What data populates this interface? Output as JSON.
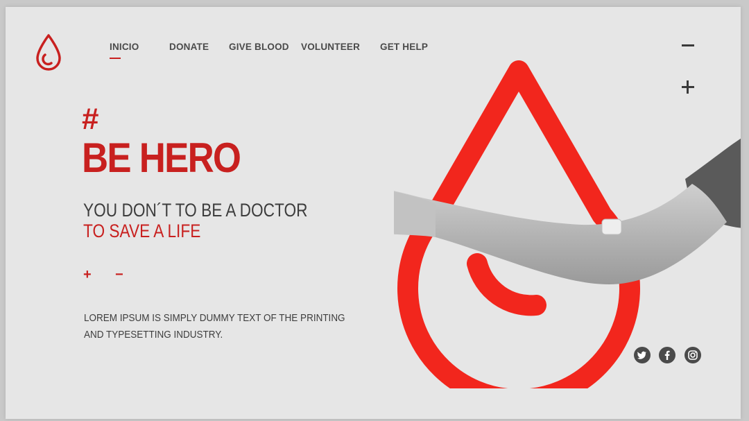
{
  "nav": {
    "items": [
      {
        "label": "INICIO",
        "active": true
      },
      {
        "label": "DONATE",
        "active": false
      },
      {
        "label": "GIVE BLOOD",
        "active": false
      },
      {
        "label": "VOLUNTEER",
        "active": false
      },
      {
        "label": "GET HELP",
        "active": false
      }
    ]
  },
  "hero": {
    "hash": "#",
    "title": "BE HERO",
    "subtitle": "YOU DON´T TO BE A DOCTOR",
    "subtitle_red": "TO SAVE A LIFE",
    "plus": "+",
    "minus": "−",
    "body": "LOREM IPSUM IS SIMPLY DUMMY TEXT OF THE PRINTING AND TYPESETTING INDUSTRY."
  },
  "icons": {
    "logo": "blood-drop-icon",
    "zoom_out": "minus-icon",
    "zoom_in": "plus-icon",
    "social": [
      "twitter-icon",
      "facebook-icon",
      "instagram-icon"
    ]
  },
  "colors": {
    "brand_red": "#c8201f",
    "drop_red": "#f2261d",
    "text_dark": "#3d3d3d",
    "background": "#e6e6e6"
  }
}
